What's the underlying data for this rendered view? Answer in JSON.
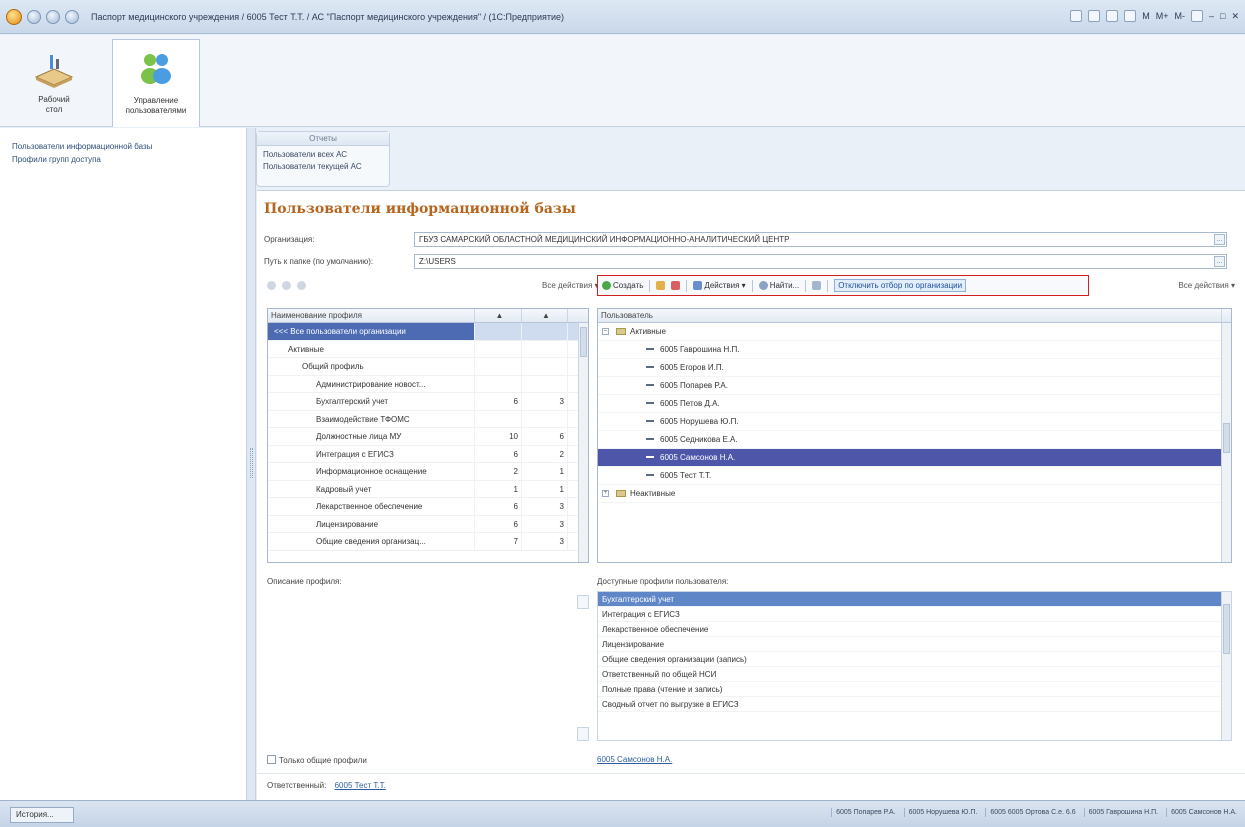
{
  "window": {
    "title": "Паспорт медицинского учреждения / 6005 Тест Т.Т. / АС \"Паспорт медицинского учреждения\" / (1С:Предприятие)",
    "right_items": [
      "M",
      "M+",
      "M-"
    ]
  },
  "ribbon": {
    "items": [
      {
        "label": "Рабочий\nстол"
      },
      {
        "label": "Управление\nпользователями"
      }
    ]
  },
  "left_panel": {
    "links": [
      "Пользователи информационной базы",
      "Профили групп доступа"
    ]
  },
  "reports": {
    "header": "Отчеты",
    "items": [
      "Пользователи всех АС",
      "Пользователи текущей АС"
    ]
  },
  "form": {
    "title": "Пользователи информационной базы",
    "org_label": "Организация:",
    "org_value": "ГБУЗ САМАРСКИЙ ОБЛАСТНОЙ МЕДИЦИНСКИЙ ИНФОРМАЦИОННО-АНАЛИТИЧЕСКИЙ ЦЕНТР",
    "path_label": "Путь к папке (по умолчанию):",
    "path_value": "Z:\\USERS",
    "all_actions_left": "Все действия ▾",
    "all_actions_right": "Все действия ▾",
    "toolbar": {
      "create": "Создать",
      "actions": "Действия ▾",
      "find": "Найти...",
      "disable_filter": "Отключить отбор по организации"
    },
    "profiles_grid": {
      "header": "Наименование профиля",
      "rows": [
        {
          "name": "<<< Все пользователи организации",
          "a": "",
          "b": "",
          "level": 0
        },
        {
          "name": "Активные",
          "a": "",
          "b": "",
          "level": 1
        },
        {
          "name": "Общий профиль",
          "a": "",
          "b": "",
          "level": 2
        },
        {
          "name": "Администрирование новост...",
          "a": "",
          "b": "",
          "level": 3
        },
        {
          "name": "Бухгалтерский учет",
          "a": "6",
          "b": "3",
          "level": 3
        },
        {
          "name": "Взаимодействие ТФОМС",
          "a": "",
          "b": "",
          "level": 3
        },
        {
          "name": "Должностные лица МУ",
          "a": "10",
          "b": "6",
          "level": 3
        },
        {
          "name": "Интеграция с ЕГИСЗ",
          "a": "6",
          "b": "2",
          "level": 3
        },
        {
          "name": "Информационное оснащение",
          "a": "2",
          "b": "1",
          "level": 3
        },
        {
          "name": "Кадровый учет",
          "a": "1",
          "b": "1",
          "level": 3
        },
        {
          "name": "Лекарственное обеспечение",
          "a": "6",
          "b": "3",
          "level": 3
        },
        {
          "name": "Лицензирование",
          "a": "6",
          "b": "3",
          "level": 3
        },
        {
          "name": "Общие сведения организац...",
          "a": "7",
          "b": "3",
          "level": 3
        }
      ]
    },
    "users_grid": {
      "header": "Пользователь",
      "active_group": "Активные",
      "users": [
        "6005 Гаврошина Н.П.",
        "6005 Егоров И.П.",
        "6005 Попарев Р.А.",
        "6005 Петов Д.А.",
        "6005 Норушева Ю.П.",
        "6005 Седникова Е.А.",
        "6005 Самсонов Н.А.",
        "6005 Тест Т.Т."
      ],
      "inactive_group": "Неактивные"
    },
    "description_label": "Описание профиля:",
    "available_label": "Доступные профили пользователя:",
    "available_profiles": [
      "Бухгалтерский учет",
      "Интеграция с ЕГИСЗ",
      "Лекарственное обеспечение",
      "Лицензирование",
      "Общие сведения организации (запись)",
      "Ответственный по общей НСИ",
      "Полные права (чтение и запись)",
      "Сводный отчет по выгрузке в ЕГИСЗ"
    ],
    "only_common_label": "Только общие профили",
    "selected_user_link": "6005 Самсонов Н.А.",
    "responsible_label": "Ответственный:",
    "responsible_link": "6005 Тест Т.Т."
  },
  "statusbar": {
    "history": "История...",
    "windows": [
      "6005 Попарев Р.А.",
      "6005 Норушева Ю.П.",
      "6005 6005 Ортова С.е. 6.6",
      "6005 Гаврошина Н.П.",
      "6005 Самсонов Н.А."
    ]
  }
}
